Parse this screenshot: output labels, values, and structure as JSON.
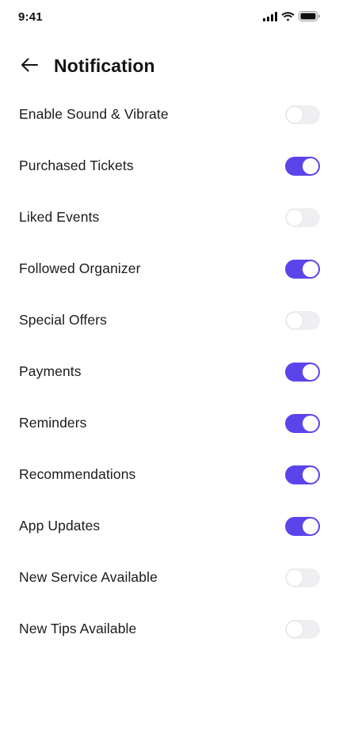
{
  "status_bar": {
    "time": "9:41"
  },
  "header": {
    "title": "Notification"
  },
  "colors": {
    "accent": "#5b45ea",
    "toggle_off": "#efeff1",
    "text": "#1b1b1b"
  },
  "settings": [
    {
      "label": "Enable Sound & Vibrate",
      "enabled": false
    },
    {
      "label": "Purchased Tickets",
      "enabled": true
    },
    {
      "label": "Liked Events",
      "enabled": false
    },
    {
      "label": "Followed Organizer",
      "enabled": true
    },
    {
      "label": "Special Offers",
      "enabled": false
    },
    {
      "label": "Payments",
      "enabled": true
    },
    {
      "label": "Reminders",
      "enabled": true
    },
    {
      "label": "Recommendations",
      "enabled": true
    },
    {
      "label": "App Updates",
      "enabled": true
    },
    {
      "label": "New Service Available",
      "enabled": false
    },
    {
      "label": "New Tips Available",
      "enabled": false
    }
  ]
}
